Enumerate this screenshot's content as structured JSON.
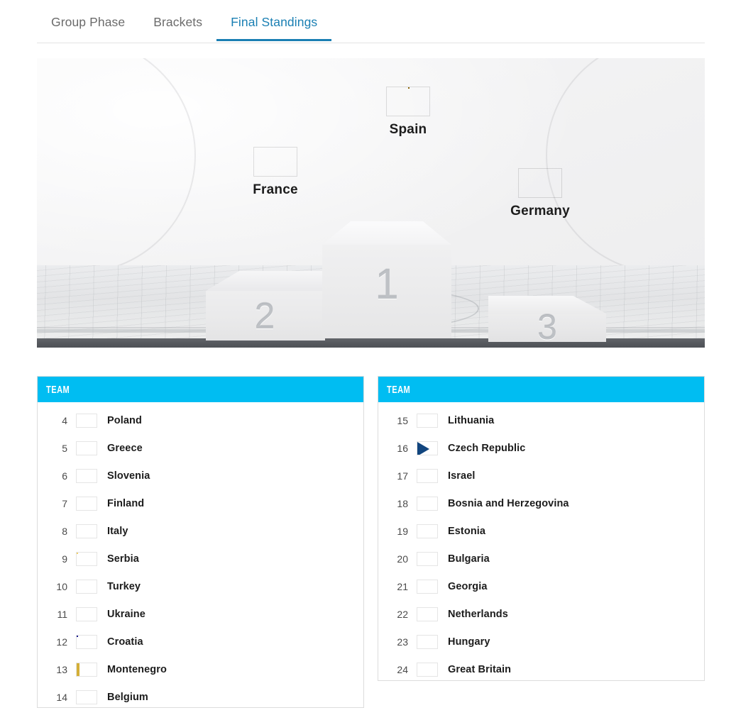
{
  "tabs": [
    {
      "label": "Group Phase",
      "active": false
    },
    {
      "label": "Brackets",
      "active": false
    },
    {
      "label": "Final Standings",
      "active": true
    }
  ],
  "podium": {
    "places": [
      {
        "position": "1",
        "team": "Spain",
        "flag": "spain"
      },
      {
        "position": "2",
        "team": "France",
        "flag": "france"
      },
      {
        "position": "3",
        "team": "Germany",
        "flag": "germany"
      }
    ]
  },
  "tables": [
    {
      "header": "TEAM",
      "rows": [
        {
          "rank": "4",
          "team": "Poland",
          "flag": "poland"
        },
        {
          "rank": "5",
          "team": "Greece",
          "flag": "greece"
        },
        {
          "rank": "6",
          "team": "Slovenia",
          "flag": "slovenia"
        },
        {
          "rank": "7",
          "team": "Finland",
          "flag": "finland"
        },
        {
          "rank": "8",
          "team": "Italy",
          "flag": "italy"
        },
        {
          "rank": "9",
          "team": "Serbia",
          "flag": "serbia"
        },
        {
          "rank": "10",
          "team": "Turkey",
          "flag": "turkey"
        },
        {
          "rank": "11",
          "team": "Ukraine",
          "flag": "ukraine"
        },
        {
          "rank": "12",
          "team": "Croatia",
          "flag": "croatia"
        },
        {
          "rank": "13",
          "team": "Montenegro",
          "flag": "montenegro"
        },
        {
          "rank": "14",
          "team": "Belgium",
          "flag": "belgium"
        }
      ]
    },
    {
      "header": "TEAM",
      "rows": [
        {
          "rank": "15",
          "team": "Lithuania",
          "flag": "lithuania"
        },
        {
          "rank": "16",
          "team": "Czech Republic",
          "flag": "czech"
        },
        {
          "rank": "17",
          "team": "Israel",
          "flag": "israel"
        },
        {
          "rank": "18",
          "team": "Bosnia and Herzegovina",
          "flag": "bosnia"
        },
        {
          "rank": "19",
          "team": "Estonia",
          "flag": "estonia"
        },
        {
          "rank": "20",
          "team": "Bulgaria",
          "flag": "bulgaria"
        },
        {
          "rank": "21",
          "team": "Georgia",
          "flag": "georgia"
        },
        {
          "rank": "22",
          "team": "Netherlands",
          "flag": "netherlands"
        },
        {
          "rank": "23",
          "team": "Hungary",
          "flag": "hungary"
        },
        {
          "rank": "24",
          "team": "Great Britain",
          "flag": "gb"
        }
      ]
    }
  ],
  "colors": {
    "accent_header": "#00bdf2",
    "active_tab": "#1a7fb3",
    "tab_inactive": "#6b6b6b",
    "stage_band": "#55585d"
  }
}
